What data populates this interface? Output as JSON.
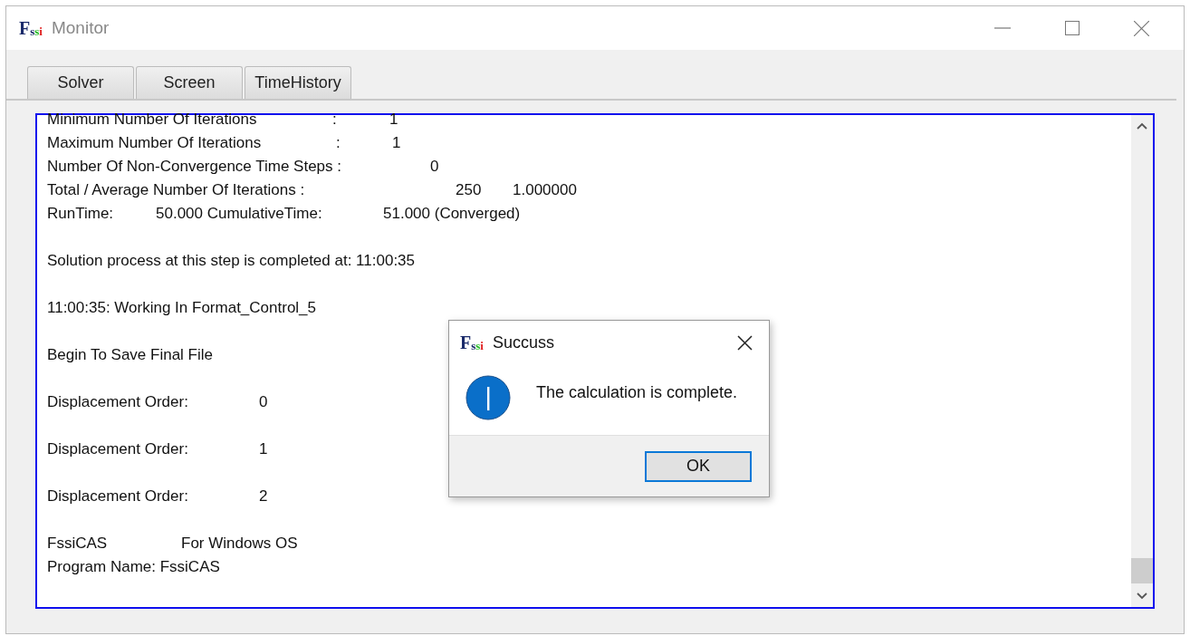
{
  "window": {
    "logo": "Fssi",
    "title": "Monitor"
  },
  "tabs": [
    {
      "label": "Solver"
    },
    {
      "label": "Screen"
    },
    {
      "label": "TimeHistory"
    }
  ],
  "log": [
    [
      [
        "Minimum Number Of Iterations",
        ":",
        "1"
      ],
      [
        "Maximum Number Of Iterations",
        ":",
        "1"
      ],
      [
        "Number Of Non-Convergence Time Steps :",
        "0"
      ],
      [
        "Total / Average Number Of Iterations :",
        "250",
        "1.000000"
      ],
      [
        "RunTime:",
        "50.000 CumulativeTime:",
        "51.000 (Converged)"
      ]
    ],
    [
      [
        "Solution process at this step is completed at: 11:00:35"
      ]
    ],
    [
      [
        "11:00:35: Working In Format_Control_5"
      ]
    ],
    [
      [
        "Begin To Save Final File"
      ]
    ],
    [
      [
        "Displacement Order:",
        "0"
      ]
    ],
    [
      [
        "Displacement Order:",
        "1"
      ]
    ],
    [
      [
        "Displacement Order:",
        "2"
      ]
    ],
    [
      [
        "FssiCAS",
        "For Windows OS"
      ],
      [
        "Program Name: FssiCAS"
      ]
    ]
  ],
  "dialog": {
    "logo": "Fssi",
    "title": "Succuss",
    "message": "The calculation is complete.",
    "button": "OK"
  }
}
